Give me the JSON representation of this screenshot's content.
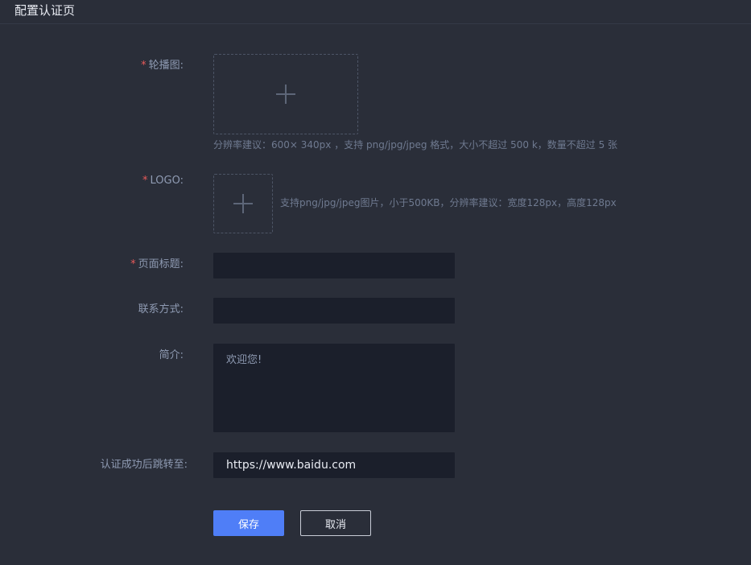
{
  "header": {
    "title": "配置认证页"
  },
  "form": {
    "carousel": {
      "required_mark": "*",
      "label": "轮播图:",
      "hint": "分辨率建议：600× 340px ，支持 png/jpg/jpeg 格式，大小不超过 500 k，数量不超过 5 张"
    },
    "logo": {
      "required_mark": "*",
      "label": "LOGO:",
      "hint": "支持png/jpg/jpeg图片，小于500KB，分辨率建议：宽度128px，高度128px"
    },
    "page_title": {
      "required_mark": "*",
      "label": "页面标题:",
      "value": ""
    },
    "contact": {
      "label": "联系方式:",
      "value": ""
    },
    "intro": {
      "label": "简介:",
      "placeholder": "欢迎您!"
    },
    "redirect": {
      "label": "认证成功后跳转至:",
      "value": "https://www.baidu.com"
    }
  },
  "actions": {
    "save_label": "保存",
    "cancel_label": "取消"
  },
  "colors": {
    "background": "#2a2e39",
    "input_background": "#1b1f2b",
    "primary": "#4f7ef7",
    "required": "#e85a5a"
  }
}
